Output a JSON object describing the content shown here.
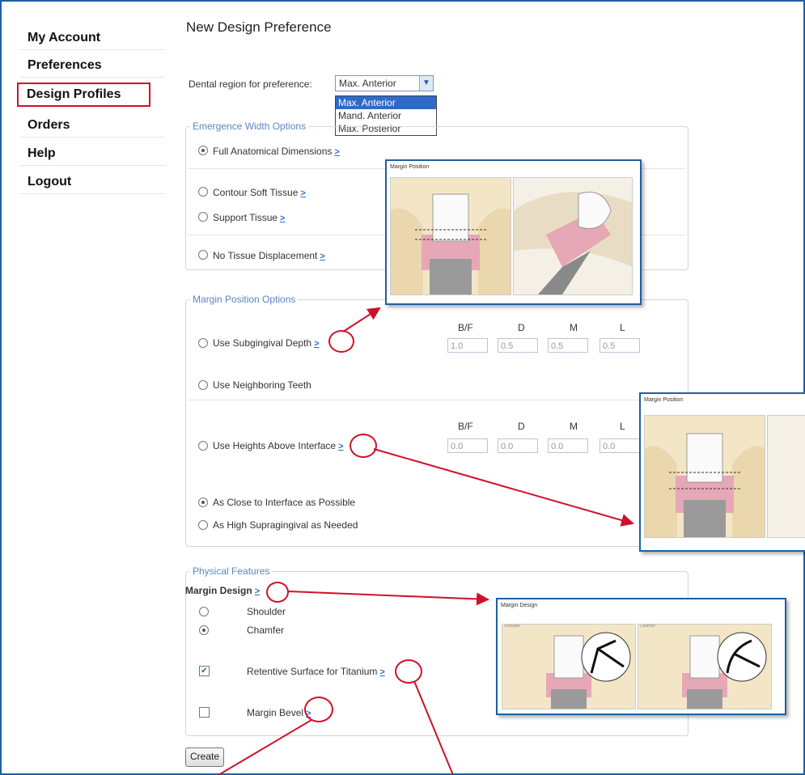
{
  "sidebar": {
    "items": [
      {
        "label": "My Account"
      },
      {
        "label": "Preferences"
      },
      {
        "label": "Design Profiles"
      },
      {
        "label": "Orders"
      },
      {
        "label": "Help"
      },
      {
        "label": "Logout"
      }
    ],
    "active_index": 2
  },
  "page": {
    "title": "New Design Preference"
  },
  "region": {
    "label": "Dental region for preference:",
    "selected": "Max. Anterior",
    "options": [
      "Max. Anterior",
      "Mand. Anterior",
      "Max. Posterior"
    ]
  },
  "emergence": {
    "legend": "Emergence Width Options",
    "options": [
      {
        "label": "Full Anatomical Dimensions",
        "help": ">",
        "checked": true
      },
      {
        "label": "Contour Soft Tissue",
        "help": ">",
        "checked": false
      },
      {
        "label": "Support Tissue",
        "help": ">",
        "checked": false
      },
      {
        "label": "No Tissue Displacement",
        "help": ">",
        "checked": false
      }
    ]
  },
  "margin_position": {
    "legend": "Margin Position Options",
    "columns": [
      "B/F",
      "D",
      "M",
      "L"
    ],
    "subgingival": {
      "label": "Use Subgingival Depth",
      "help": ">",
      "values": [
        "1.0",
        "0.5",
        "0.5",
        "0.5"
      ]
    },
    "neighboring": {
      "label": "Use Neighboring Teeth"
    },
    "heights": {
      "label": "Use Heights Above Interface",
      "help": ">",
      "values": [
        "0.0",
        "0.0",
        "0.0",
        "0.0"
      ]
    },
    "close": {
      "label": "As Close to Interface as Possible",
      "checked": true
    },
    "high": {
      "label": "As High Supragingival as Needed",
      "checked": false
    }
  },
  "physical": {
    "legend": "Physical Features",
    "margin_design_label": "Margin Design",
    "help": ">",
    "shoulder": "Shoulder",
    "chamfer": "Chamfer",
    "chamfer_checked": true,
    "retentive": "Retentive Surface for Titanium",
    "retentive_checked": true,
    "bevel": "Margin Bevel",
    "bevel_checked": false
  },
  "create_button": "Create",
  "popups": {
    "margin_position_title": "Margin Position",
    "margin_design_title": "Margin Design",
    "panel_shoulder": "Shoulder",
    "panel_chamfer": "Chamfer"
  },
  "colors": {
    "accent": "#1f5fa3",
    "highlight": "#d0102a",
    "legend": "#5b87bd"
  }
}
